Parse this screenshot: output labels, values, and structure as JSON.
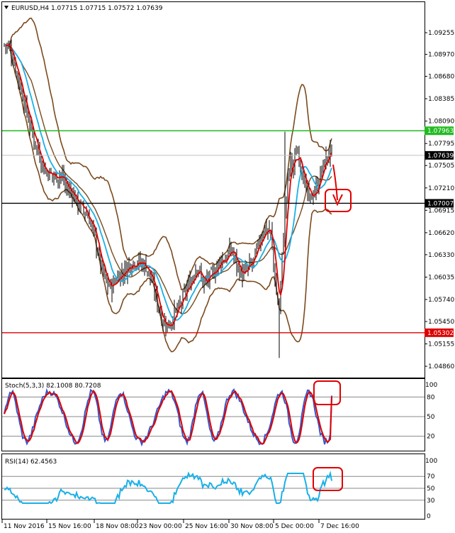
{
  "chart_data": {
    "type": "candlestick",
    "main": {
      "header": "EURUSD,H4  1.07715 1.07715 1.07572 1.07639",
      "ylim": [
        1.0473,
        1.0948
      ],
      "price_ticks": [
        "1.09255",
        "1.08970",
        "1.08680",
        "1.08385",
        "1.08090",
        "1.07795",
        "1.07505",
        "1.07210",
        "1.06915",
        "1.06620",
        "1.06330",
        "1.06035",
        "1.05740",
        "1.05450",
        "1.05155",
        "1.04860"
      ],
      "hlines": [
        {
          "value": 1.07963,
          "label": "1.07963",
          "color": "#22bb22"
        },
        {
          "value": 1.07007,
          "label": "1.07007",
          "color": "#000000"
        },
        {
          "value": 1.05302,
          "label": "1.05302",
          "color": "#dd0000"
        }
      ],
      "current_price": {
        "value": 1.07639,
        "label": "1.07639"
      },
      "close_path": [
        [
          0,
          1.091
        ],
        [
          4,
          1.0905
        ],
        [
          8,
          1.088
        ],
        [
          12,
          1.085
        ],
        [
          16,
          1.082
        ],
        [
          20,
          1.079
        ],
        [
          24,
          1.077
        ],
        [
          28,
          1.0745
        ],
        [
          32,
          1.074
        ],
        [
          36,
          1.0735
        ],
        [
          40,
          1.074
        ],
        [
          44,
          1.072
        ],
        [
          48,
          1.0715
        ],
        [
          52,
          1.07
        ],
        [
          56,
          1.0692
        ],
        [
          60,
          1.068
        ],
        [
          64,
          1.0655
        ],
        [
          68,
          1.062
        ],
        [
          72,
          1.0595
        ],
        [
          76,
          1.059
        ],
        [
          80,
          1.0605
        ],
        [
          84,
          1.061
        ],
        [
          88,
          1.062
        ],
        [
          92,
          1.0625
        ],
        [
          96,
          1.0622
        ],
        [
          100,
          1.0618
        ],
        [
          104,
          1.0598
        ],
        [
          108,
          1.057
        ],
        [
          112,
          1.0545
        ],
        [
          116,
          1.054
        ],
        [
          120,
          1.0555
        ],
        [
          124,
          1.0565
        ],
        [
          128,
          1.0585
        ],
        [
          132,
          1.06
        ],
        [
          136,
          1.062
        ],
        [
          140,
          1.0595
        ],
        [
          144,
          1.06
        ],
        [
          148,
          1.061
        ],
        [
          152,
          1.0625
        ],
        [
          156,
          1.0628
        ],
        [
          160,
          1.064
        ],
        [
          164,
          1.062
        ],
        [
          168,
          1.0605
        ],
        [
          172,
          1.0615
        ],
        [
          176,
          1.0625
        ],
        [
          180,
          1.065
        ],
        [
          184,
          1.067
        ],
        [
          188,
          1.066
        ],
        [
          192,
          1.058
        ],
        [
          194,
          1.056
        ],
        [
          196,
          1.063
        ],
        [
          198,
          1.069
        ],
        [
          200,
          1.073
        ],
        [
          202,
          1.076
        ],
        [
          204,
          1.0745
        ],
        [
          206,
          1.077
        ],
        [
          208,
          1.0765
        ],
        [
          210,
          1.0745
        ],
        [
          212,
          1.0725
        ],
        [
          214,
          1.071
        ],
        [
          216,
          1.0705
        ],
        [
          218,
          1.0715
        ],
        [
          220,
          1.072
        ],
        [
          222,
          1.0732
        ],
        [
          224,
          1.0745
        ],
        [
          226,
          1.0755
        ],
        [
          228,
          1.0762
        ],
        [
          230,
          1.077
        ],
        [
          231,
          1.0764
        ]
      ]
    },
    "stoch": {
      "header": "Stoch(5,3,3) 82.1008 80.7208",
      "ylim": [
        0,
        100
      ],
      "levels": [
        "80",
        "50",
        "20"
      ],
      "top_label": "100"
    },
    "rsi": {
      "header": "RSI(14) 62.4563",
      "ylim": [
        0,
        100
      ],
      "levels": [
        "70",
        "50",
        "30"
      ],
      "top_label": "100",
      "bottom_label": "0"
    },
    "x_labels": [
      "11 Nov 2016",
      "15 Nov 16:00",
      "18 Nov 08:00",
      "23 Nov 00:00",
      "25 Nov 16:00",
      "30 Nov 08:00",
      "5 Dec 00:00",
      "7 Dec 16:00"
    ],
    "colors": {
      "candle": "#000000",
      "ma_fast": "#e00000",
      "ma_slow": "#1ab0e8",
      "bollinger": "#7a4a1e",
      "stoch_main": "#3355cc",
      "stoch_signal": "#e00000",
      "rsi": "#1ab0e8",
      "annotation": "#e00000"
    }
  }
}
